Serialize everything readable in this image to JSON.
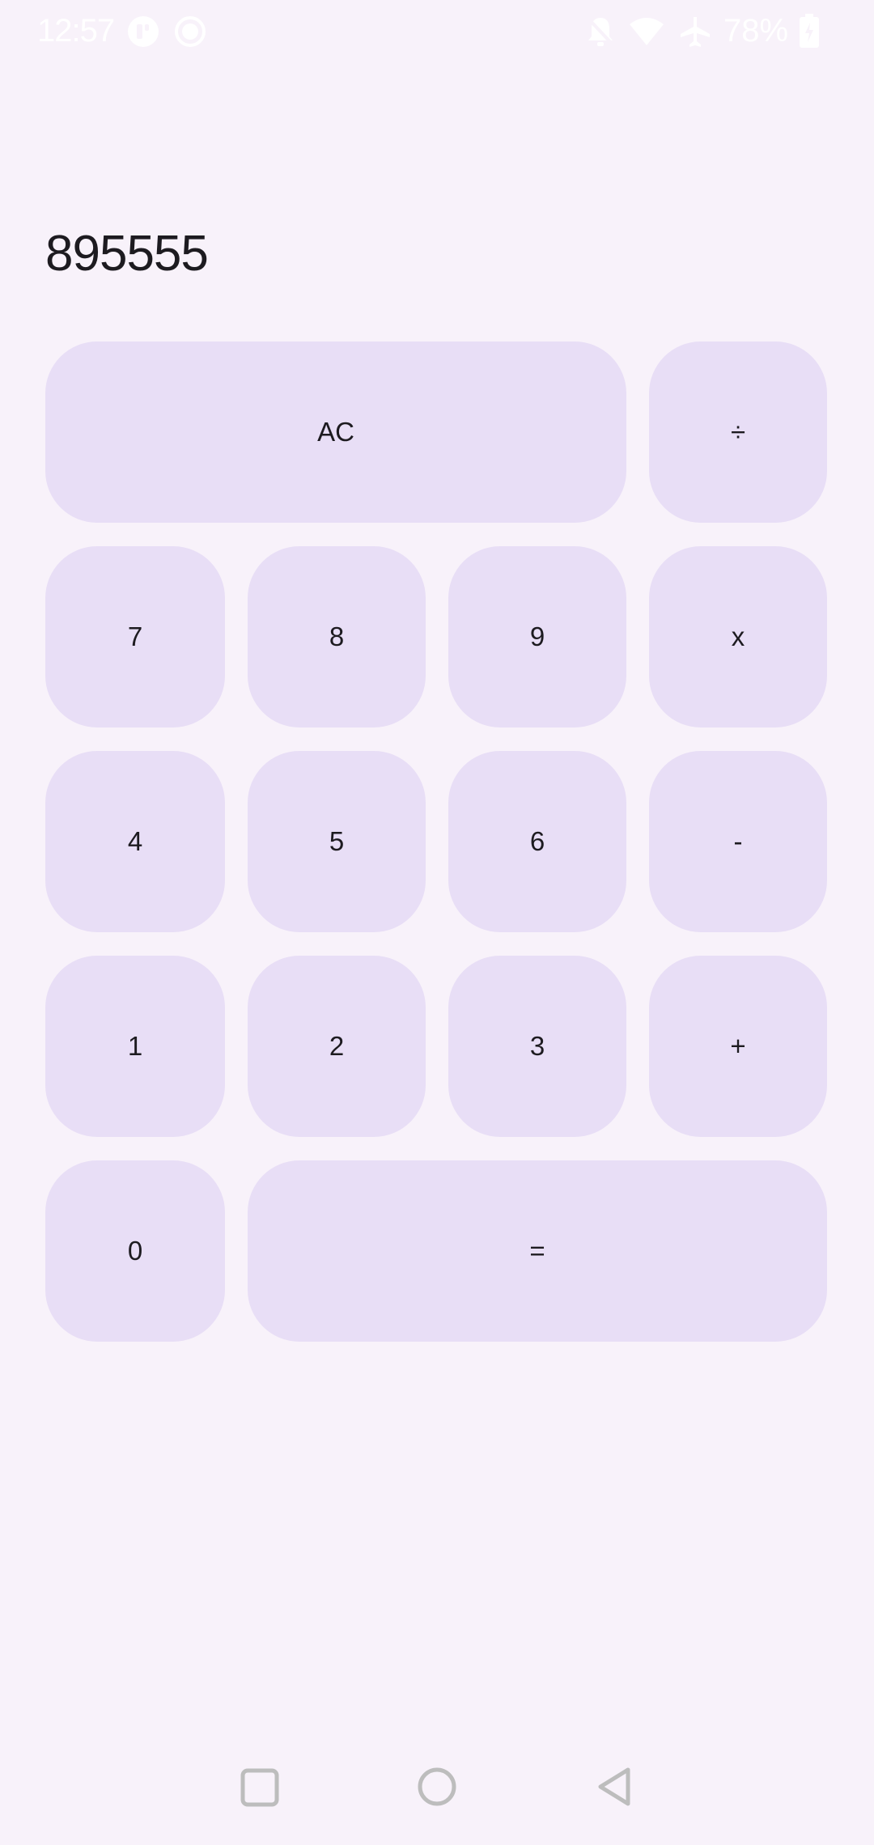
{
  "status_bar": {
    "time": "12:57",
    "battery": "78%",
    "icons": [
      "app-notification-icon",
      "record-icon",
      "bell-muted-icon",
      "wifi-icon",
      "airplane-mode-icon",
      "battery-icon"
    ]
  },
  "display": {
    "value": "895555"
  },
  "keys": {
    "ac": "AC",
    "divide": "÷",
    "seven": "7",
    "eight": "8",
    "nine": "9",
    "multiply": "x",
    "four": "4",
    "five": "5",
    "six": "6",
    "minus": "-",
    "one": "1",
    "two": "2",
    "three": "3",
    "plus": "+",
    "zero": "0",
    "equals": "="
  },
  "colors": {
    "background": "#f8f2fa",
    "key_fill": "#e8def6",
    "text": "#1d1b20",
    "nav_icons": "#bdbdbd"
  },
  "nav_bar": {
    "icons": [
      "recents-square-icon",
      "home-circle-icon",
      "back-triangle-icon"
    ]
  }
}
